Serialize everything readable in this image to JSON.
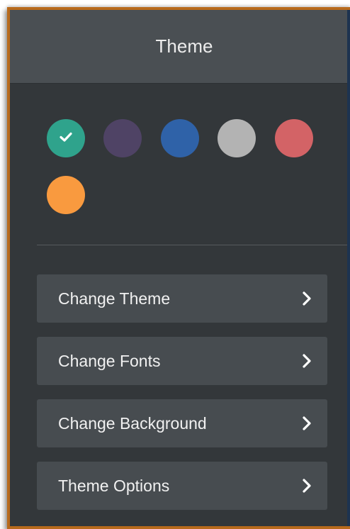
{
  "panel": {
    "title": "Theme"
  },
  "swatches": [
    {
      "name": "teal",
      "color": "#2fa38c",
      "selected": true,
      "icon": "checkmark-icon"
    },
    {
      "name": "purple",
      "color": "#4f4365",
      "selected": false
    },
    {
      "name": "blue",
      "color": "#2f62a8",
      "selected": false
    },
    {
      "name": "gray",
      "color": "#b3b3b3",
      "selected": false
    },
    {
      "name": "red",
      "color": "#d36366",
      "selected": false
    },
    {
      "name": "orange",
      "color": "#f99a3f",
      "selected": false
    }
  ],
  "menu": [
    {
      "label": "Change Theme",
      "icon": "chevron-right-icon"
    },
    {
      "label": "Change Fonts",
      "icon": "chevron-right-icon"
    },
    {
      "label": "Change Background",
      "icon": "chevron-right-icon"
    },
    {
      "label": "Theme Options",
      "icon": "chevron-right-icon"
    }
  ],
  "colors": {
    "panel_bg": "#33373a",
    "header_bg": "#4a4f53",
    "item_bg": "#474c50",
    "frame_border": "#b86a1c"
  }
}
